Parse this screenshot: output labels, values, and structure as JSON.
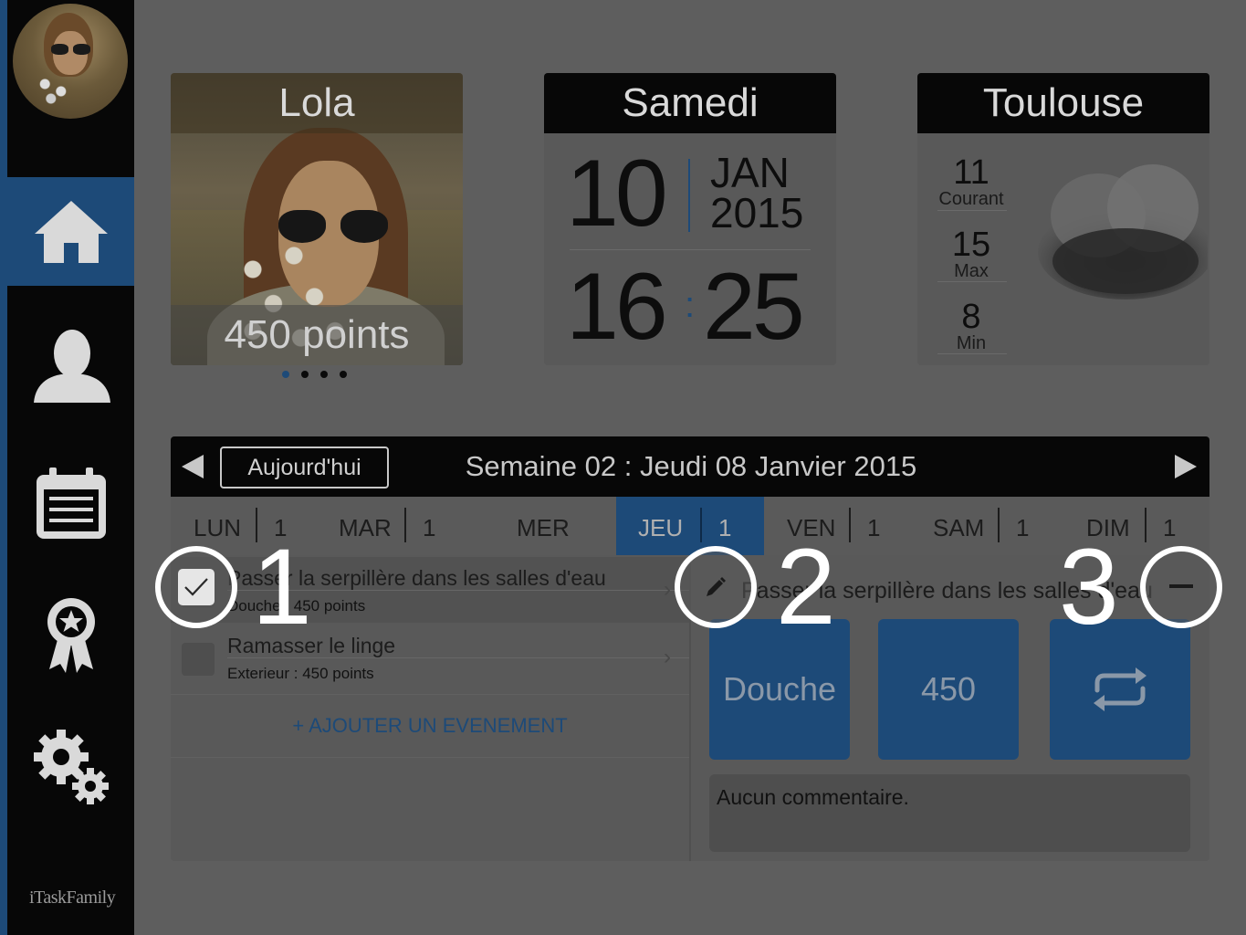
{
  "app": {
    "logo_text": "iTaskFamily"
  },
  "sidebar": {
    "items": [
      {
        "name": "home",
        "icon": "home-icon",
        "active": true
      },
      {
        "name": "profile",
        "icon": "user-icon",
        "active": false
      },
      {
        "name": "calendar",
        "icon": "calendar-icon",
        "active": false
      },
      {
        "name": "rewards",
        "icon": "award-ribbon-icon",
        "active": false
      },
      {
        "name": "settings",
        "icon": "gears-icon",
        "active": false
      }
    ]
  },
  "profile_card": {
    "name": "Lola",
    "points": "450 points",
    "page_count": 4,
    "active_page": 1
  },
  "date_card": {
    "weekday": "Samedi",
    "day": "10",
    "month": "JAN",
    "year": "2015",
    "hour": "16",
    "minute": "25",
    "separator": ":"
  },
  "weather_card": {
    "city": "Toulouse",
    "current": {
      "value": "11",
      "label": "Courant"
    },
    "max": {
      "value": "15",
      "label": "Max"
    },
    "min": {
      "value": "8",
      "label": "Min"
    },
    "icon": "cloud-icon"
  },
  "week": {
    "today_label": "Aujourd'hui",
    "title": "Semaine 02 : Jeudi 08 Janvier 2015",
    "days": [
      {
        "name": "LUN",
        "count": "1"
      },
      {
        "name": "MAR",
        "count": "1"
      },
      {
        "name": "MER",
        "count": ""
      },
      {
        "name": "JEU",
        "count": "1",
        "active": true
      },
      {
        "name": "VEN",
        "count": "1"
      },
      {
        "name": "SAM",
        "count": "1"
      },
      {
        "name": "DIM",
        "count": "1"
      }
    ]
  },
  "tasks": [
    {
      "title": "Passer la serpillère dans les salles d'eau",
      "subtitle": "Douche : 450 points",
      "selected": true
    },
    {
      "title": "Ramasser le linge",
      "subtitle": "Exterieur : 450 points",
      "selected": false
    }
  ],
  "add_event_label": "+ AJOUTER UN EVENEMENT",
  "detail": {
    "title": "Passer la serpillère dans les salles d'eau",
    "category": "Douche",
    "points": "450",
    "repeat_icon": "repeat-icon",
    "comment": "Aucun commentaire."
  },
  "tutorial": {
    "markers": [
      "1",
      "2",
      "3"
    ]
  },
  "colors": {
    "accent": "#1d4a78",
    "bar": "#070707",
    "overlay_ring": "#ffffff"
  }
}
